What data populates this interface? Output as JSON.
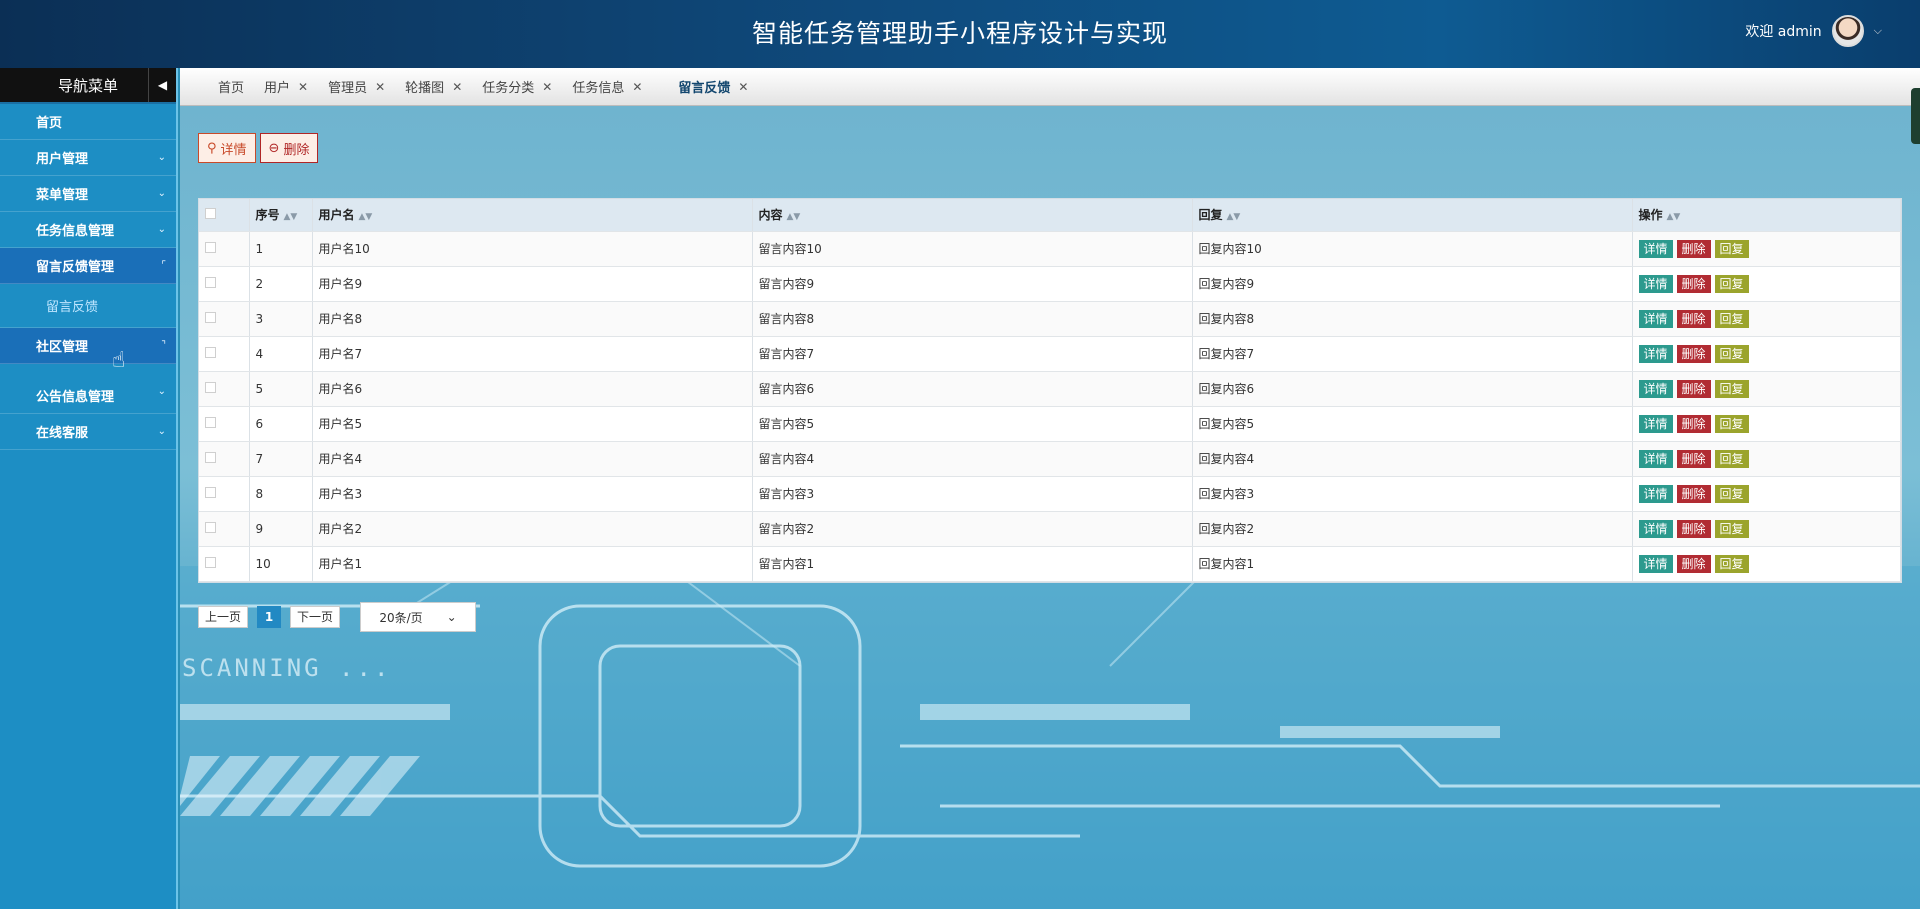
{
  "header": {
    "title": "智能任务管理助手小程序设计与实现",
    "welcome": "欢迎 admin"
  },
  "sidebar": {
    "title": "导航菜单",
    "items": [
      {
        "label": "首页"
      },
      {
        "label": "用户管理"
      },
      {
        "label": "菜单管理"
      },
      {
        "label": "任务信息管理"
      },
      {
        "label": "留言反馈管理",
        "sub": "留言反馈"
      },
      {
        "label": "社区管理"
      },
      {
        "label": "公告信息管理"
      },
      {
        "label": "在线客服"
      }
    ]
  },
  "tabs": [
    {
      "label": "首页"
    },
    {
      "label": "用户"
    },
    {
      "label": "管理员"
    },
    {
      "label": "轮播图"
    },
    {
      "label": "任务分类"
    },
    {
      "label": "任务信息"
    },
    {
      "label": "留言反馈",
      "active": true
    }
  ],
  "toolbar": {
    "detail_label": "详情",
    "delete_label": "删除"
  },
  "table": {
    "columns": [
      "序号",
      "用户名",
      "内容",
      "回复",
      "操作"
    ],
    "row_actions": [
      "详情",
      "删除",
      "回复"
    ],
    "rows": [
      {
        "no": "1",
        "user": "用户名10",
        "content": "留言内容10",
        "reply": "回复内容10"
      },
      {
        "no": "2",
        "user": "用户名9",
        "content": "留言内容9",
        "reply": "回复内容9"
      },
      {
        "no": "3",
        "user": "用户名8",
        "content": "留言内容8",
        "reply": "回复内容8"
      },
      {
        "no": "4",
        "user": "用户名7",
        "content": "留言内容7",
        "reply": "回复内容7"
      },
      {
        "no": "5",
        "user": "用户名6",
        "content": "留言内容6",
        "reply": "回复内容6"
      },
      {
        "no": "6",
        "user": "用户名5",
        "content": "留言内容5",
        "reply": "回复内容5"
      },
      {
        "no": "7",
        "user": "用户名4",
        "content": "留言内容4",
        "reply": "回复内容4"
      },
      {
        "no": "8",
        "user": "用户名3",
        "content": "留言内容3",
        "reply": "回复内容3"
      },
      {
        "no": "9",
        "user": "用户名2",
        "content": "留言内容2",
        "reply": "回复内容2"
      },
      {
        "no": "10",
        "user": "用户名1",
        "content": "留言内容1",
        "reply": "回复内容1"
      }
    ]
  },
  "pager": {
    "prev": "上一页",
    "current": "1",
    "next": "下一页",
    "page_size": "20条/页"
  },
  "background_text": "SCANNING ..."
}
